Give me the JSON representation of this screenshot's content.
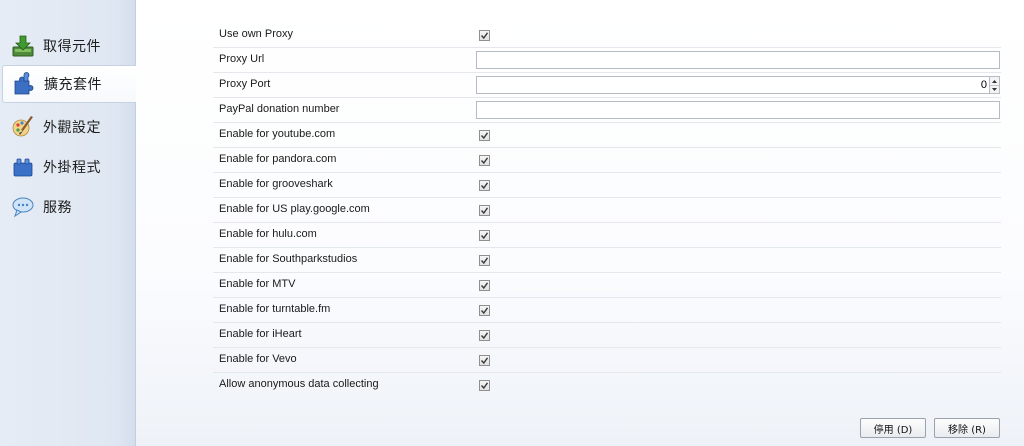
{
  "sidebar": {
    "items": [
      {
        "label": "取得元件",
        "icon": "download-icon",
        "active": false
      },
      {
        "label": "擴充套件",
        "icon": "puzzle-icon",
        "active": true
      },
      {
        "label": "外觀設定",
        "icon": "paintbrush-icon",
        "active": false
      },
      {
        "label": "外掛程式",
        "icon": "plugin-block-icon",
        "active": false
      },
      {
        "label": "服務",
        "icon": "chat-bubble-icon",
        "active": false
      }
    ]
  },
  "settings": {
    "use_own_proxy": {
      "label": "Use own Proxy",
      "checked": true
    },
    "proxy_url": {
      "label": "Proxy Url",
      "value": ""
    },
    "proxy_port": {
      "label": "Proxy Port",
      "value": "0"
    },
    "paypal": {
      "label": "PayPal donation number",
      "value": ""
    },
    "youtube": {
      "label": "Enable for youtube.com",
      "checked": true
    },
    "pandora": {
      "label": "Enable for pandora.com",
      "checked": true
    },
    "grooveshark": {
      "label": "Enable for grooveshark",
      "checked": true
    },
    "googleplay": {
      "label": "Enable for US play.google.com",
      "checked": true
    },
    "hulu": {
      "label": "Enable for hulu.com",
      "checked": true
    },
    "southpark": {
      "label": "Enable for Southparkstudios",
      "checked": true
    },
    "mtv": {
      "label": "Enable for MTV",
      "checked": true
    },
    "turntable": {
      "label": "Enable for turntable.fm",
      "checked": true
    },
    "iheart": {
      "label": "Enable for iHeart",
      "checked": true
    },
    "vevo": {
      "label": "Enable for Vevo",
      "checked": true
    },
    "anonymous": {
      "label": "Allow anonymous data collecting",
      "checked": true
    }
  },
  "buttons": {
    "disable_label": "停用 (D)",
    "remove_label": "移除 (R)"
  },
  "colors": {
    "sidebar_bg": "#dfe7f2",
    "row_divider": "#e4e7ec"
  }
}
